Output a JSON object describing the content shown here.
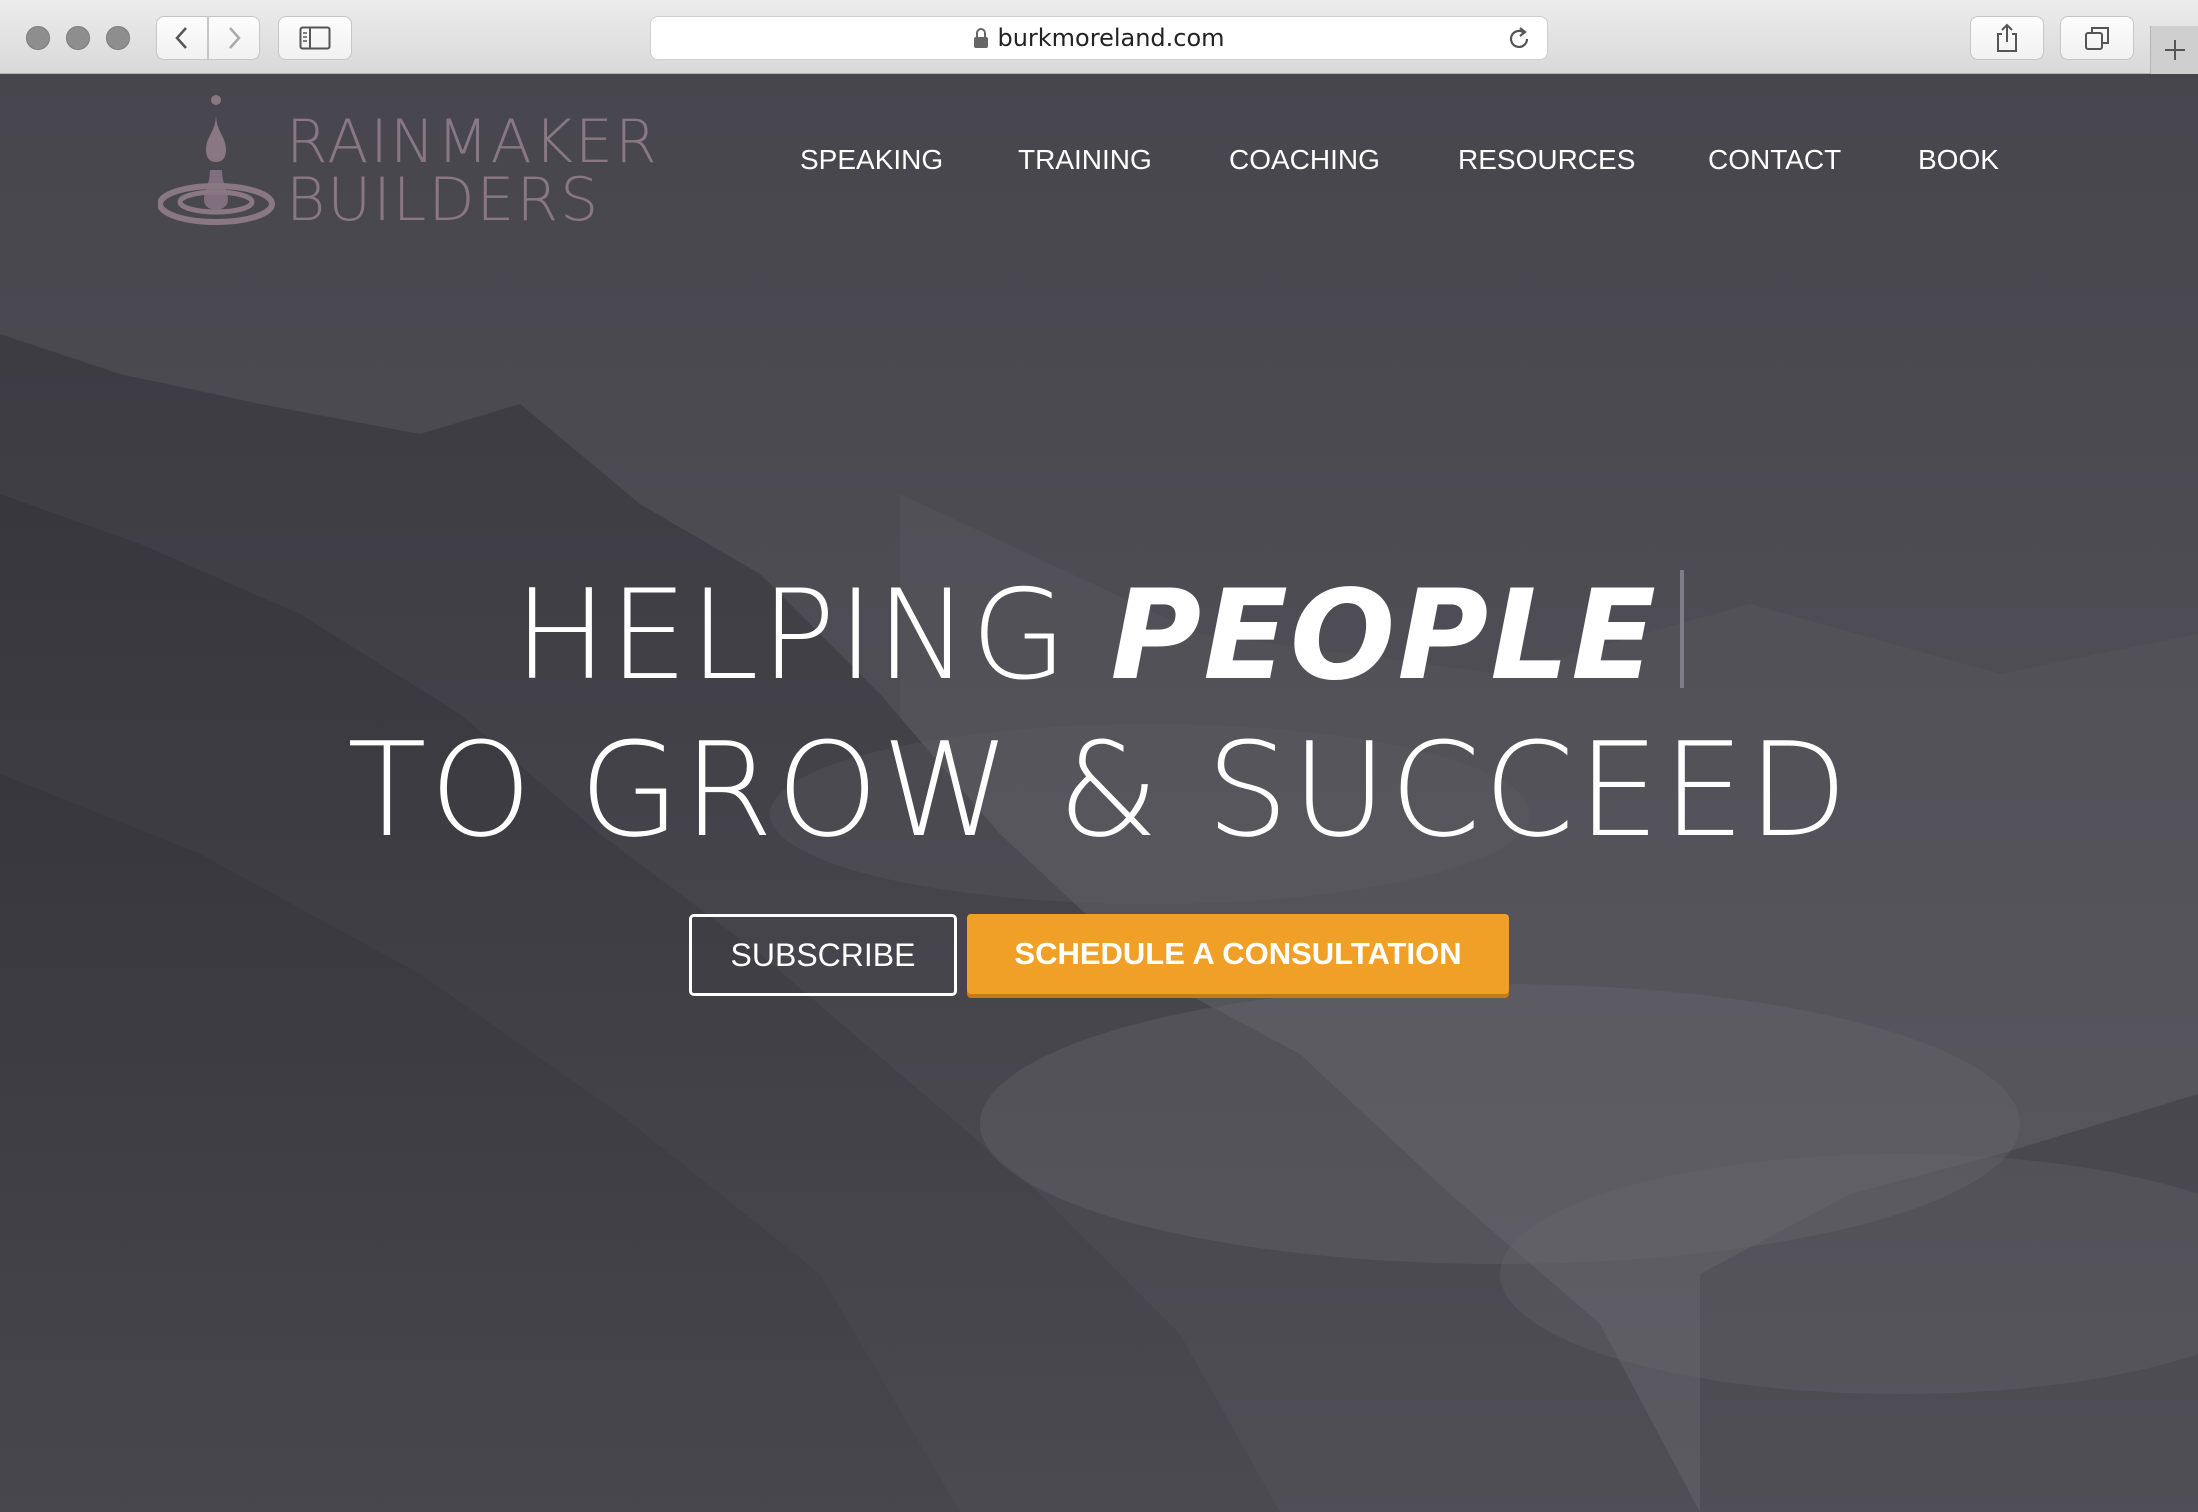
{
  "browser": {
    "url": "burkmoreland.com",
    "icons": {
      "back": "chevron-left-icon",
      "forward": "chevron-right-icon",
      "sidebar": "sidebar-icon",
      "lock": "lock-icon",
      "reload": "reload-icon",
      "share": "share-icon",
      "tabs": "tabs-icon",
      "new_tab": "plus-icon"
    }
  },
  "site": {
    "logo": {
      "line1": "RAINMAKER",
      "line2": "BUILDERS",
      "color": "#8a7784"
    },
    "nav": [
      "SPEAKING",
      "TRAINING",
      "COACHING",
      "RESOURCES",
      "CONTACT",
      "BOOK"
    ],
    "hero": {
      "headline_light": "HELPING ",
      "headline_bold": "PEOPLE",
      "headline_line2": "TO GROW & SUCCEED",
      "subscribe_label": "SUBSCRIBE",
      "schedule_label": "SCHEDULE A CONSULTATION",
      "accent_color": "#f0a026"
    }
  }
}
